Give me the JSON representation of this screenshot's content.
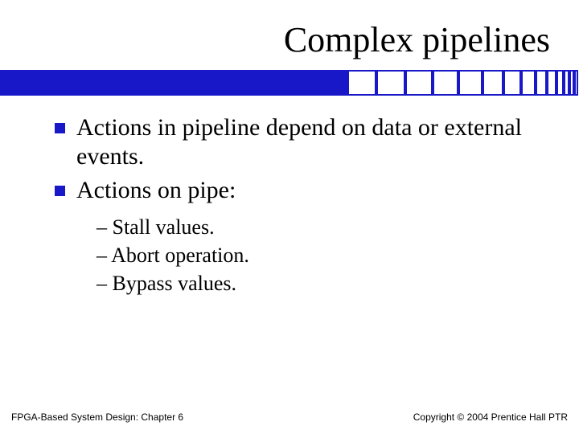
{
  "title": "Complex pipelines",
  "bullets": [
    {
      "text": "Actions in pipeline depend on data or external events."
    },
    {
      "text": "Actions on pipe:"
    }
  ],
  "sub_bullets": [
    "– Stall values.",
    "– Abort operation.",
    "– Bypass values."
  ],
  "footer": {
    "left": "FPGA-Based System Design: Chapter 6",
    "right": "Copyright © 2004 Prentice Hall PTR"
  },
  "colors": {
    "accent": "#1818c8"
  }
}
